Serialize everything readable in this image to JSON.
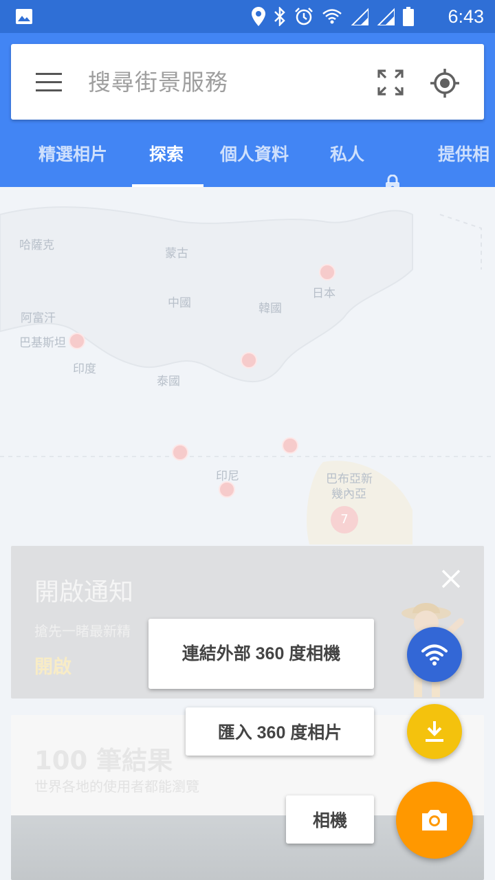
{
  "status_bar": {
    "time": "6:43",
    "icons": [
      "image-icon",
      "location-icon",
      "bluetooth-icon",
      "alarm-icon",
      "wifi-icon",
      "signal-icon",
      "signal-2-icon",
      "battery-icon"
    ],
    "background": "#2f6fd6"
  },
  "search": {
    "placeholder": "搜尋街景服務"
  },
  "tabs": [
    {
      "label": "精選相片",
      "active": false
    },
    {
      "label": "探索",
      "active": true
    },
    {
      "label": "個人資料",
      "active": false
    },
    {
      "label": "私人",
      "active": false
    },
    {
      "label": "提供相",
      "active": false
    }
  ],
  "map": {
    "labels": [
      "哈薩克",
      "蒙古",
      "日本",
      "中國",
      "韓國",
      "阿富汗",
      "巴基斯坦",
      "印度",
      "泰國",
      "印尼",
      "巴布亞新",
      "幾內亞"
    ],
    "cluster_count": "7"
  },
  "notification": {
    "title": "開啟通知",
    "subtitle": "搶先一睹最新精",
    "action": "開啟"
  },
  "results": {
    "count": "100 筆結果",
    "subtitle": "世界各地的使用者都能瀏覽"
  },
  "speed_dial": {
    "connect_label": "連結外部 360 度相機",
    "import_label": "匯入 360 度相片",
    "camera_label": "相機"
  },
  "colors": {
    "app_bar": "#4285f4",
    "fab_blue": "#3367d6",
    "fab_yellow": "#f4c20d",
    "fab_orange": "#ff9800"
  }
}
